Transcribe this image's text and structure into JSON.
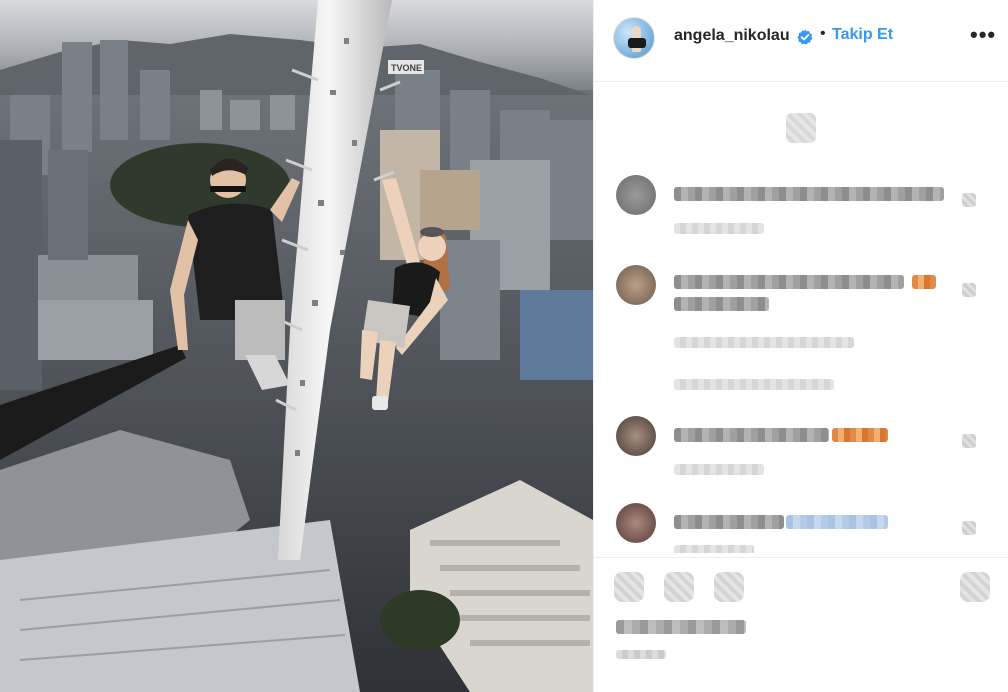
{
  "post": {
    "username": "angela_nikolau",
    "follow_label": "Takip Et",
    "separator": "•",
    "more_label": "•••",
    "sign_text": "TVONE"
  },
  "colors": {
    "accent": "#3897f0",
    "verified": "#3897f0",
    "text": "#262626",
    "border": "#efefef"
  },
  "icons": {
    "verified": "verified-badge-icon",
    "more": "more-options-icon",
    "like": "heart-icon",
    "comment": "comment-icon",
    "share": "share-icon",
    "save": "bookmark-icon"
  }
}
